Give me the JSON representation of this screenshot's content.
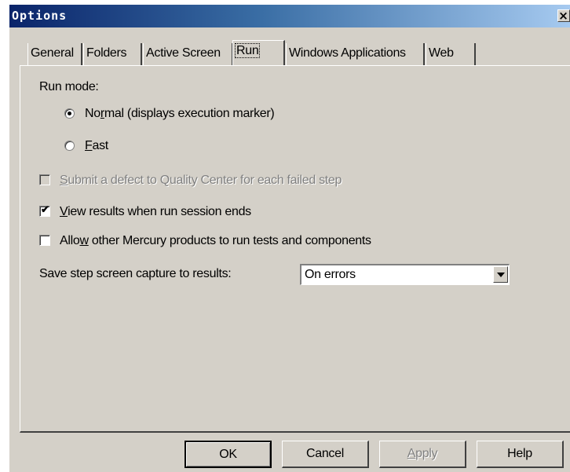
{
  "window": {
    "title": "Options",
    "close_symbol": "×"
  },
  "tabs": [
    {
      "label": "General",
      "active": false
    },
    {
      "label": "Folders",
      "active": false
    },
    {
      "label": "Active Screen",
      "active": false
    },
    {
      "label": "Run",
      "active": true
    },
    {
      "label": "Windows Applications",
      "active": false
    },
    {
      "label": "Web",
      "active": false
    }
  ],
  "run": {
    "mode_label": "Run mode:",
    "normal_pre": "No",
    "normal_u": "r",
    "normal_post": "mal (displays execution marker)",
    "normal_selected": true,
    "fast_u": "F",
    "fast_post": "ast",
    "fast_selected": false,
    "submit_defect_u": "S",
    "submit_defect_post": "ubmit a defect to Quality Center for each failed step",
    "submit_defect_checked": false,
    "submit_defect_enabled": false,
    "view_results_u": "V",
    "view_results_post": "iew results when run session ends",
    "view_results_checked": true,
    "allow_pre": "Allo",
    "allow_u": "w",
    "allow_post": " other Mercury products to run tests and components",
    "allow_checked": false,
    "save_capture_label": "Save step screen capture to results:",
    "save_capture_value": "On errors"
  },
  "buttons": {
    "ok": "OK",
    "cancel": "Cancel",
    "apply_u": "A",
    "apply_post": "pply",
    "help": "Help"
  },
  "icons": {
    "close": "close-icon",
    "dropdown": "chevron-down-icon",
    "check": "checkmark-icon",
    "radio": "radio-dot-icon"
  }
}
